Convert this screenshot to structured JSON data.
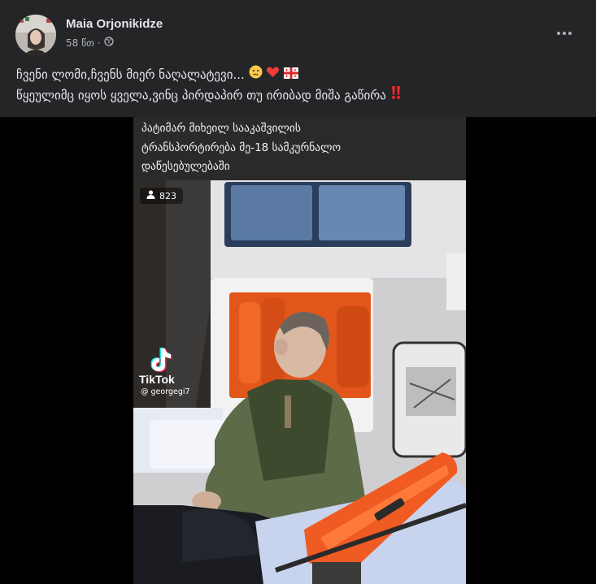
{
  "post": {
    "author": "Maia Orjonikidze",
    "time": "58 წთ",
    "separator": "·",
    "privacy_icon": "globe-icon",
    "more_icon": "more-horizontal-icon",
    "caption_line1": "ჩვენი ლომი,ჩვენს მიერ ნაღალატევი...",
    "caption_line1_emojis": [
      "confused-face-icon",
      "red-heart-icon",
      "georgian-flag-icon"
    ],
    "caption_line2": "წყეულიმც იყოს ყველა,ვინც პირდაპირ თუ ირიბად მიშა გაწირა",
    "caption_line2_emoji": "double-exclamation-icon"
  },
  "video": {
    "title_line1": "პატიმარ მიხეილ სააკაშვილის",
    "title_line2": "ტრანსპორტირება მე-18 სამკურნალო",
    "title_line3": "დაწესებულებაში",
    "viewer_count": "823",
    "viewer_icon": "person-icon",
    "watermark_brand": "TikTok",
    "watermark_handle": "@ georgegi7"
  },
  "colors": {
    "background": "#18191a",
    "card": "#242526",
    "text_primary": "#e4e6eb",
    "text_secondary": "#b0b3b8"
  }
}
